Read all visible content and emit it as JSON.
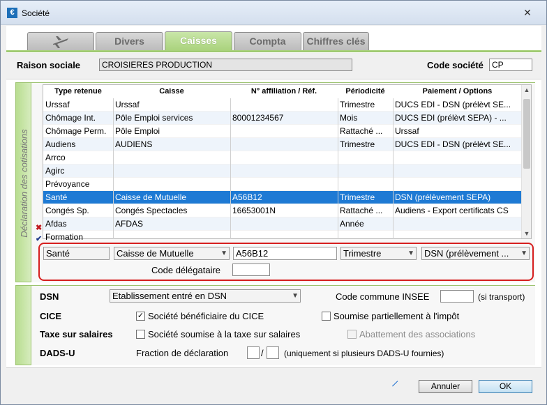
{
  "window": {
    "title": "Société"
  },
  "tabs": [
    {
      "label": ""
    },
    {
      "label": "Divers"
    },
    {
      "label": "Caisses"
    },
    {
      "label": "Compta"
    },
    {
      "label": "Chiffres clés"
    }
  ],
  "header": {
    "raison_label": "Raison sociale",
    "raison_value": "CROISIERES PRODUCTION",
    "code_label": "Code société",
    "code_value": "CP"
  },
  "cotisations": {
    "section_label": "Déclaration des cotisations",
    "columns": [
      "Type retenue",
      "Caisse",
      "N° affiliation / Réf.",
      "Périodicité",
      "Paiement / Options"
    ],
    "rows": [
      {
        "type": "Urssaf",
        "caisse": "Urssaf",
        "affiliation": "",
        "periodicite": "Trimestre",
        "paiement": "DUCS EDI - DSN (prélèvt SE..."
      },
      {
        "type": "Chômage Int.",
        "caisse": "Pôle Emploi services",
        "affiliation": "80001234567",
        "periodicite": "Mois",
        "paiement": "DUCS EDI (prélèvt SEPA) - ..."
      },
      {
        "type": "Chômage Perm.",
        "caisse": "Pôle Emploi",
        "affiliation": "",
        "periodicite": "Rattaché ...",
        "paiement": "Urssaf"
      },
      {
        "type": "Audiens",
        "caisse": "AUDIENS",
        "affiliation": "",
        "periodicite": "Trimestre",
        "paiement": "DUCS EDI - DSN (prélèvt SE..."
      },
      {
        "type": "Arrco",
        "caisse": "",
        "affiliation": "",
        "periodicite": "",
        "paiement": ""
      },
      {
        "type": "Agirc",
        "caisse": "",
        "affiliation": "",
        "periodicite": "",
        "paiement": ""
      },
      {
        "type": "Prévoyance",
        "caisse": "",
        "affiliation": "",
        "periodicite": "",
        "paiement": ""
      },
      {
        "type": "Santé",
        "caisse": "Caisse de Mutuelle",
        "affiliation": "A56B12",
        "periodicite": "Trimestre",
        "paiement": "DSN (prélèvement SEPA)"
      },
      {
        "type": "Congés Sp.",
        "caisse": "Congés Spectacles",
        "affiliation": "16653001N",
        "periodicite": "Rattaché ...",
        "paiement": "Audiens - Export certificats CS"
      },
      {
        "type": "Afdas",
        "caisse": "AFDAS",
        "affiliation": "",
        "periodicite": "Année",
        "paiement": ""
      },
      {
        "type": "Formation",
        "caisse": "",
        "affiliation": "",
        "periodicite": "",
        "paiement": ""
      }
    ],
    "marks": {
      "cross": "✖",
      "check": "✔"
    }
  },
  "edit": {
    "type": "Santé",
    "caisse": "Caisse de Mutuelle",
    "affiliation": "A56B12",
    "periodicite": "Trimestre",
    "paiement": "DSN (prélèvement ...",
    "delegataire_label": "Code délégataire",
    "delegataire_value": ""
  },
  "bottom": {
    "dsn_label": "DSN",
    "dsn_value": "Etablissement entré en DSN",
    "insee_label": "Code commune INSEE",
    "insee_note": "(si transport)",
    "cice_label": "CICE",
    "cice_option": "Société bénéficiaire du CICE",
    "cice_checked": "✓",
    "impot_option": "Soumise partiellement à l'impôt",
    "taxe_label": "Taxe sur salaires",
    "taxe_option": "Société soumise à la taxe sur salaires",
    "abattement_option": "Abattement des associations",
    "dadsu_label": "DADS-U",
    "fraction_label": "Fraction de déclaration",
    "fraction_sep": "/",
    "fraction_note": "(uniquement si plusieurs DADS-U fournies)"
  },
  "footer": {
    "cancel": "Annuler",
    "ok": "OK"
  }
}
